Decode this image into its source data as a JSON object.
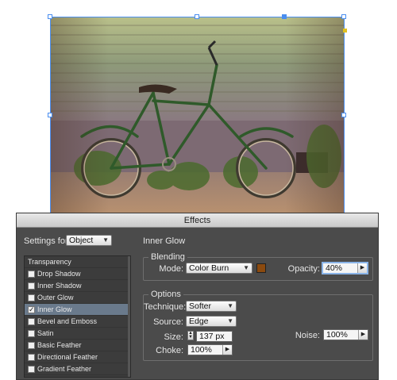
{
  "dialog": {
    "title": "Effects",
    "settings_for_label": "Settings for:",
    "settings_for_value": "Object",
    "section_title": "Inner Glow"
  },
  "effect_list": {
    "items": [
      {
        "label": "Transparency",
        "has_checkbox": false,
        "checked": false
      },
      {
        "label": "Drop Shadow",
        "has_checkbox": true,
        "checked": false
      },
      {
        "label": "Inner Shadow",
        "has_checkbox": true,
        "checked": false
      },
      {
        "label": "Outer Glow",
        "has_checkbox": true,
        "checked": false
      },
      {
        "label": "Inner Glow",
        "has_checkbox": true,
        "checked": true
      },
      {
        "label": "Bevel and Emboss",
        "has_checkbox": true,
        "checked": false
      },
      {
        "label": "Satin",
        "has_checkbox": true,
        "checked": false
      },
      {
        "label": "Basic Feather",
        "has_checkbox": true,
        "checked": false
      },
      {
        "label": "Directional Feather",
        "has_checkbox": true,
        "checked": false
      },
      {
        "label": "Gradient Feather",
        "has_checkbox": true,
        "checked": false
      }
    ]
  },
  "blending": {
    "title": "Blending",
    "mode_label": "Mode:",
    "mode_value": "Color Burn",
    "color": "#8b4a0f",
    "opacity_label": "Opacity:",
    "opacity_value": "40%"
  },
  "options": {
    "title": "Options",
    "technique_label": "Technique:",
    "technique_value": "Softer",
    "source_label": "Source:",
    "source_value": "Edge",
    "size_label": "Size:",
    "size_value": "137 px",
    "choke_label": "Choke:",
    "choke_value": "100%",
    "noise_label": "Noise:",
    "noise_value": "100%"
  },
  "icons": {
    "dropdown": "chevron-down-icon",
    "stepper": "stepper-icon",
    "checkmark": "checkmark-icon"
  },
  "colors": {
    "dialog_bg": "#4b4b4b",
    "selection": "#4a8ef0",
    "active_item": "#6a7a8c"
  }
}
